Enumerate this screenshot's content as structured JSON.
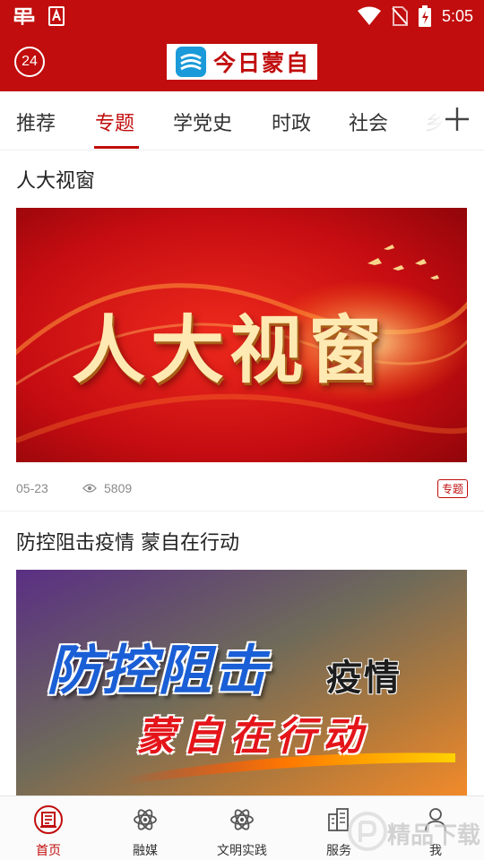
{
  "status_bar": {
    "time": "5:05"
  },
  "header": {
    "badge": "24",
    "logo_text": "今日蒙自"
  },
  "tabs": [
    {
      "label": "推荐",
      "active": false
    },
    {
      "label": "专题",
      "active": true
    },
    {
      "label": "学党史",
      "active": false
    },
    {
      "label": "时政",
      "active": false
    },
    {
      "label": "社会",
      "active": false
    },
    {
      "label": "乡",
      "active": false
    }
  ],
  "articles": [
    {
      "title": "人大视窗",
      "image_text": "人大视窗",
      "date": "05-23",
      "views": "5809",
      "tag": "专题"
    },
    {
      "title": "防控阻击疫情  蒙自在行动",
      "image_line1_a": "防控阻击",
      "image_line1_b": "疫情",
      "image_line2": "蒙自在行动"
    }
  ],
  "bottom_nav": [
    {
      "label": "首页",
      "icon": "newspaper-icon",
      "active": true
    },
    {
      "label": "融媒",
      "icon": "atom-icon",
      "active": false
    },
    {
      "label": "文明实践",
      "icon": "atom-icon",
      "active": false
    },
    {
      "label": "服务",
      "icon": "buildings-icon",
      "active": false
    },
    {
      "label": "我",
      "icon": "user-icon",
      "active": false
    }
  ],
  "watermark": "精品下载",
  "colors": {
    "brand_red": "#c10d0d",
    "text": "#222222",
    "meta": "#8a8a8a"
  }
}
